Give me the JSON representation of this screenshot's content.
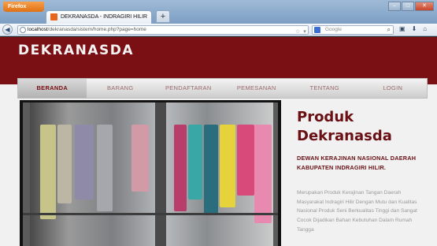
{
  "browser": {
    "app_button": "Firefox",
    "tab_title": "DEKRANASDA - INDRAGIRI HILIR",
    "new_tab": "+",
    "url_host": "localhost",
    "url_path": "/dekranasda/sistem/home.php?page=home",
    "search_placeholder": "Google"
  },
  "site": {
    "brand": "DEKRANASDA",
    "menu": [
      {
        "label": "BERANDA",
        "active": true
      },
      {
        "label": "BARANG",
        "active": false
      },
      {
        "label": "PENDAFTARAN",
        "active": false
      },
      {
        "label": "PEMESANAN",
        "active": false
      },
      {
        "label": "TENTANG",
        "active": false
      },
      {
        "label": "LOGIN",
        "active": false
      }
    ],
    "side": {
      "title": "Produk Dekranasda",
      "subtitle": "DEWAN KERAJINAN NASIONAL DAERAH KABUPATEN INDRAGIRI HILIR.",
      "body": "Merupakan Produk Kerajinan Tangan Daerah Masyarakat Indragiri Hilir Dengan Mutu dan Kualitas Nasional Produk Seni Berkualitas Tinggi dan Sangat Cocok Dijadikan Bahan Kebutuhan Dalam Rumah Tangga"
    }
  },
  "colors": {
    "header": "#7a0f14",
    "accent_text": "#6a1014"
  }
}
